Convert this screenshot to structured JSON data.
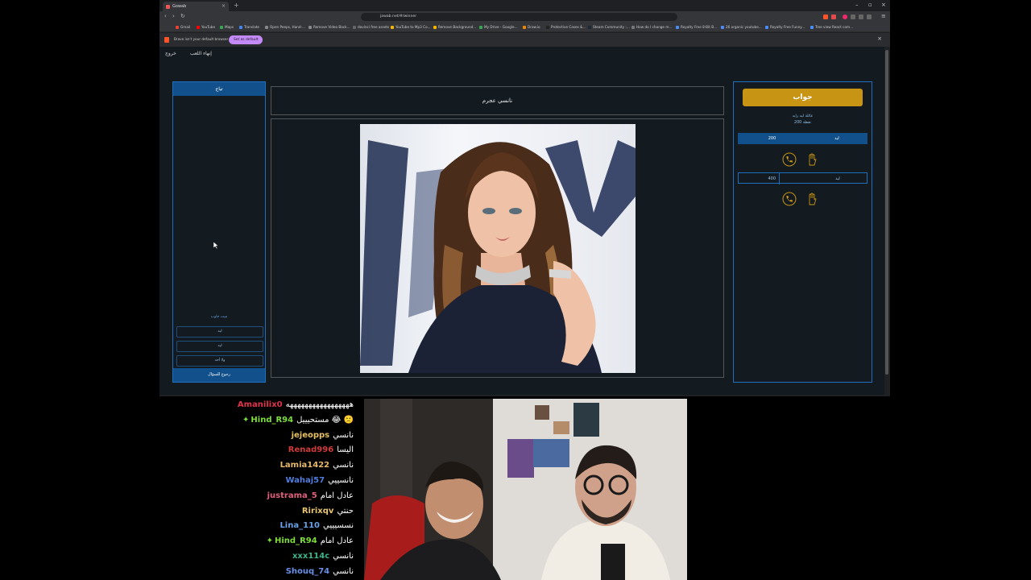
{
  "browser": {
    "tab_title": "Gowab",
    "address": "jawab.net/#/winner",
    "infobar_text": "Brave isn't your default browser",
    "infobar_button": "Set as default",
    "bookmarks": [
      {
        "label": "Gmail",
        "color": "#ea4335"
      },
      {
        "label": "YouTube",
        "color": "#ff0000"
      },
      {
        "label": "Maps",
        "color": "#34a853"
      },
      {
        "label": "Translate",
        "color": "#4285f4"
      },
      {
        "label": "Open Peeps, Hand-...",
        "color": "#888888"
      },
      {
        "label": "Remove Video Back...",
        "color": "#888888"
      },
      {
        "label": "davinci free assets",
        "color": "#666666"
      },
      {
        "label": "YouTube to Mp3 Co...",
        "color": "#f5b400"
      },
      {
        "label": "Remove Background...",
        "color": "#f5b400"
      },
      {
        "label": "My Drive - Google...",
        "color": "#34a853"
      },
      {
        "label": "Draw.io",
        "color": "#f08705"
      },
      {
        "label": "Protective Cases &...",
        "color": "#222222"
      },
      {
        "label": "Steam Community :...",
        "color": "#1b2838"
      },
      {
        "label": "How do I change m...",
        "color": "#777777"
      },
      {
        "label": "Royalty Free 8-Bit B...",
        "color": "#4a8df8"
      },
      {
        "label": "26 organic youtube...",
        "color": "#4a8df8"
      },
      {
        "label": "Royalty Free Funny...",
        "color": "#4a8df8"
      },
      {
        "label": "Tree view React com...",
        "color": "#4a8df8"
      }
    ]
  },
  "page": {
    "exit_label": "خروج",
    "end_game_label": "إنهاء اللعب",
    "left": {
      "header": "تياج",
      "no_answer": "ميت جاوب",
      "buttons": [
        "ليد",
        "ليد",
        "ولا أحد"
      ],
      "back_label": "رجوع للسؤال"
    },
    "question_title": "نانسي عجرم",
    "right": {
      "logo_text": "جواب",
      "team_label": "عائلة ليد رايد",
      "points_label": "200 نقطة",
      "rows": [
        {
          "value": "200",
          "name": "ليد",
          "highlight": true
        },
        {
          "value": "400",
          "name": "ليد",
          "highlight": false
        }
      ],
      "accent": "#c79414"
    }
  },
  "chat": [
    {
      "user": "Amanilix0",
      "msg": "هههههههههههههههههه",
      "color": "#e0334c",
      "badge": false
    },
    {
      "user": "Hind_R94",
      "msg": "مستحيييل 😂 🙁",
      "color": "#7ddd3a",
      "badge": true
    },
    {
      "user": "jejeopps",
      "msg": "نانسي",
      "color": "#e5c062",
      "badge": false
    },
    {
      "user": "Renad996",
      "msg": "اليسا",
      "color": "#d23a3a",
      "badge": false
    },
    {
      "user": "Lamia1422",
      "msg": "نانسي",
      "color": "#e5b86a",
      "badge": false
    },
    {
      "user": "Wahaj57",
      "msg": "نانسييي",
      "color": "#4f7ddd",
      "badge": false
    },
    {
      "user": "justrama_5",
      "msg": "عادل امام",
      "color": "#e0607a",
      "badge": false
    },
    {
      "user": "Ririxqv",
      "msg": "حنتي",
      "color": "#e8c46a",
      "badge": false
    },
    {
      "user": "Lina_110",
      "msg": "نسسيييي",
      "color": "#6aa0e6",
      "badge": false
    },
    {
      "user": "Hind_R94",
      "msg": "عادل امام",
      "color": "#7ddd3a",
      "badge": true
    },
    {
      "user": "xxx114c",
      "msg": "نانسي",
      "color": "#3fb38a",
      "badge": false
    },
    {
      "user": "Shouq_74",
      "msg": "نانسي",
      "color": "#6a8fe6",
      "badge": false
    }
  ]
}
